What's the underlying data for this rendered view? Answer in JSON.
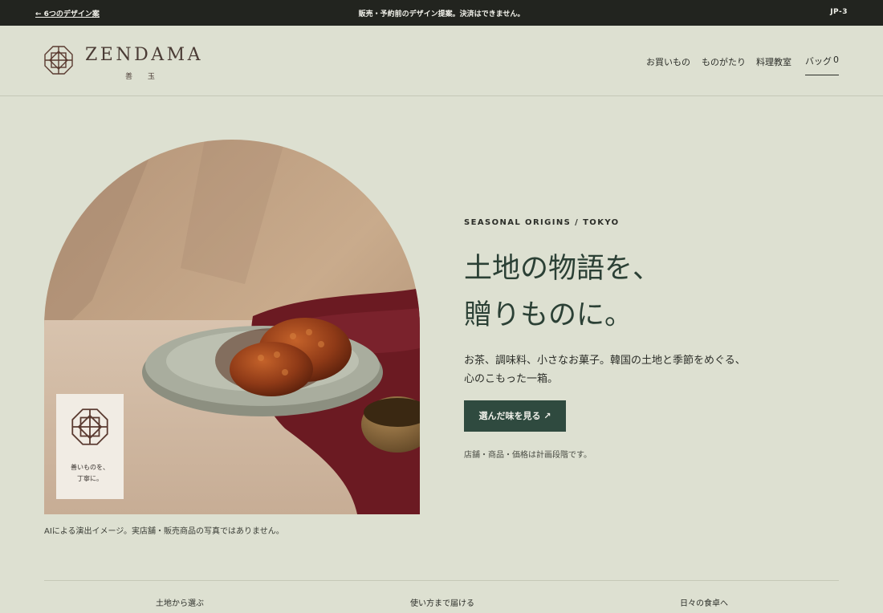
{
  "topbar": {
    "back_label": "← 6つのデザイン案",
    "notice": "販売・予約前のデザイン提案。決済はできません。",
    "code": "JP-3"
  },
  "header": {
    "brand": "ZENDAMA",
    "brand_sub": "善 玉",
    "nav": [
      "お買いもの",
      "ものがたり",
      "料理教室"
    ],
    "bag_label": "バッグ",
    "bag_count": "0"
  },
  "hero": {
    "badge_text_1": "善いものを、",
    "badge_text_2": "丁寧に。",
    "caption": "AIによる演出イメージ。実店舗・販売商品の写真ではありません。",
    "eyebrow": "SEASONAL ORIGINS / TOKYO",
    "headline_1": "土地の物語を、",
    "headline_2": "贈りものに。",
    "body_1": "お茶、調味料、小さなお菓子。韓国の土地と季節をめぐる、",
    "body_2": "心のこもった一箱。",
    "cta_label": "選んだ味を見る ↗",
    "note": "店舗・商品・価格は計画段階です。"
  },
  "bottom_nav": [
    "土地から選ぶ",
    "使い方まで届ける",
    "日々の食卓へ"
  ],
  "colors": {
    "page_bg": "#dde0d1",
    "topbar_bg": "#22241f",
    "accent_green": "#2f4a3f",
    "brand_brown": "#4a3b35"
  }
}
